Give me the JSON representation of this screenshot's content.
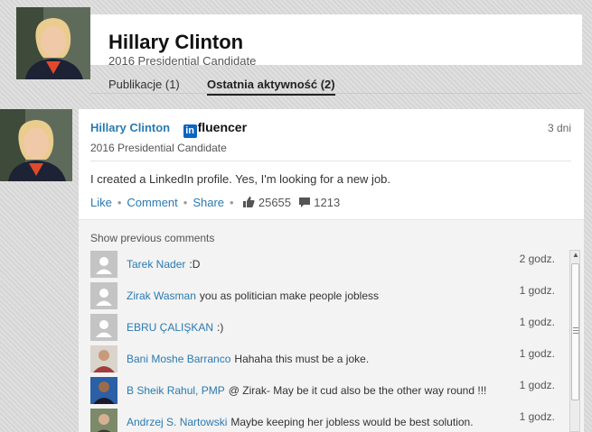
{
  "profile": {
    "name": "Hillary Clinton",
    "title": "2016 Presidential Candidate",
    "tabs": [
      {
        "label": "Publikacje (1)"
      },
      {
        "label": "Ostatnia aktywność (2)"
      }
    ]
  },
  "post": {
    "author": "Hillary Clinton",
    "badge": "fluencer",
    "badge_logo": "in",
    "author_title": "2016 Presidential Candidate",
    "time": "3 dni",
    "text": "I created a LinkedIn profile. Yes, I'm looking for a new job.",
    "actions": {
      "like": "Like",
      "comment": "Comment",
      "share": "Share"
    },
    "likes": "25655",
    "comments_count": "1213"
  },
  "comments": {
    "show_previous": "Show previous comments",
    "items": [
      {
        "author": "Tarek Nader",
        "text": ":D",
        "time": "2 godz."
      },
      {
        "author": "Zirak Wasman",
        "text": "you as politician make people jobless",
        "time": "1 godz."
      },
      {
        "author": "EBRU ÇALIŞKAN",
        "text": ":)",
        "time": "1 godz."
      },
      {
        "author": "Bani Moshe Barranco",
        "text": "Hahaha this must be a joke.",
        "time": "1 godz."
      },
      {
        "author": "B Sheik Rahul, PMP",
        "text": "@ Zirak- May be it cud also be the other way round !!!",
        "time": "1 godz."
      },
      {
        "author": "Andrzej S. Nartowski",
        "text": "Maybe keeping her jobless would be best solution.",
        "time": "1 godz."
      }
    ]
  },
  "colors": {
    "link": "#2a7ab0",
    "linkedin_blue": "#0a66c2"
  }
}
